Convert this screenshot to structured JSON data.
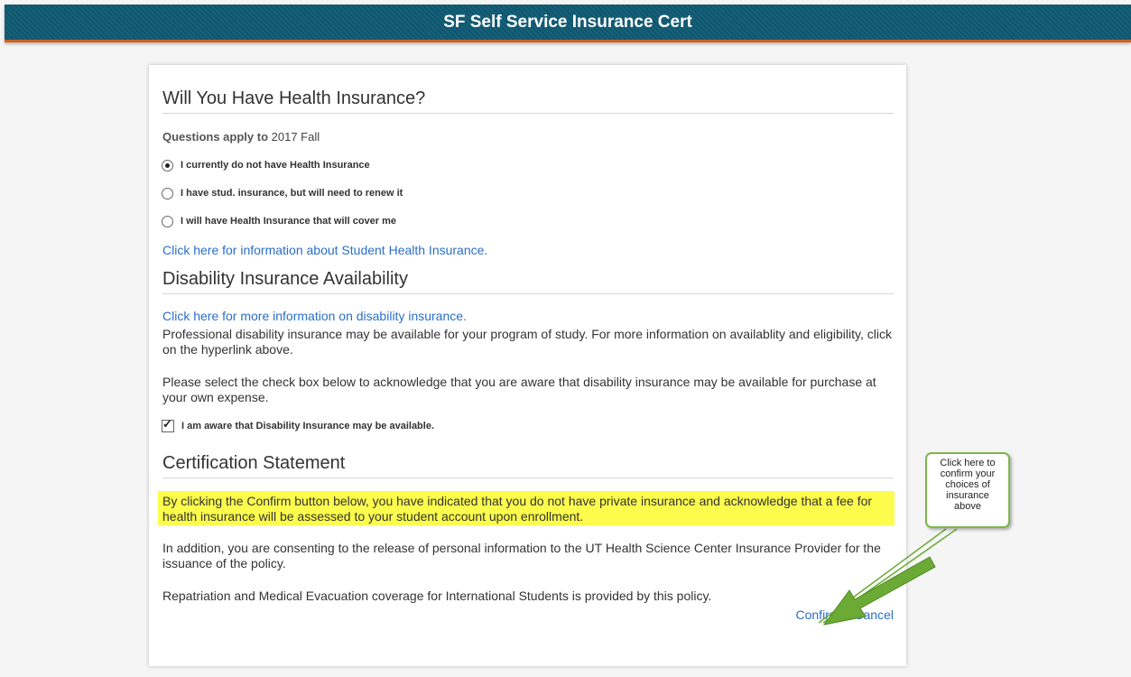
{
  "header": {
    "title": "SF Self Service Insurance Cert"
  },
  "health": {
    "title": "Will You Have Health Insurance?",
    "questions_prefix": "Questions apply to",
    "term": "2017 Fall",
    "options": [
      {
        "label": "I currently do not have Health Insurance",
        "selected": true
      },
      {
        "label": "I have stud. insurance, but will need to renew it",
        "selected": false
      },
      {
        "label": "I will have Health Insurance that will cover me",
        "selected": false
      }
    ],
    "info_link": "Click here for information about Student Health Insurance."
  },
  "disability": {
    "title": "Disability Insurance Availability",
    "info_link": "Click here for more information on disability insurance.",
    "para1": "Professional disability insurance may be available for your program of study. For more information on availablity and eligibility, click on the hyperlink above.",
    "para2": "Please select the check box below to acknowledge that you are aware that disability insurance may be available for purchase at your own expense.",
    "checkbox_label": "I am aware that Disability Insurance may be available.",
    "checkbox_checked": true
  },
  "certification": {
    "title": "Certification Statement",
    "highlighted": "By clicking the Confirm button below, you have indicated that you do not have private insurance and acknowledge that a fee for health insurance will be assessed to your student account upon enrollment.",
    "para_release": "In addition, you are consenting to the release of personal information to the UT Health Science Center Insurance Provider for the issuance of the policy.",
    "para_repatriation": "Repatriation and Medical Evacuation coverage for International Students is provided by this policy."
  },
  "actions": {
    "confirm": "Confirm",
    "cancel": "Cancel"
  },
  "callout": {
    "text": "Click here to confirm your choices of insurance above"
  },
  "colors": {
    "header_bg": "#0f5a73",
    "header_accent": "#d2611f",
    "link": "#2a6fc9",
    "highlight": "#fcfc4c",
    "annotation": "#6aaa35"
  }
}
